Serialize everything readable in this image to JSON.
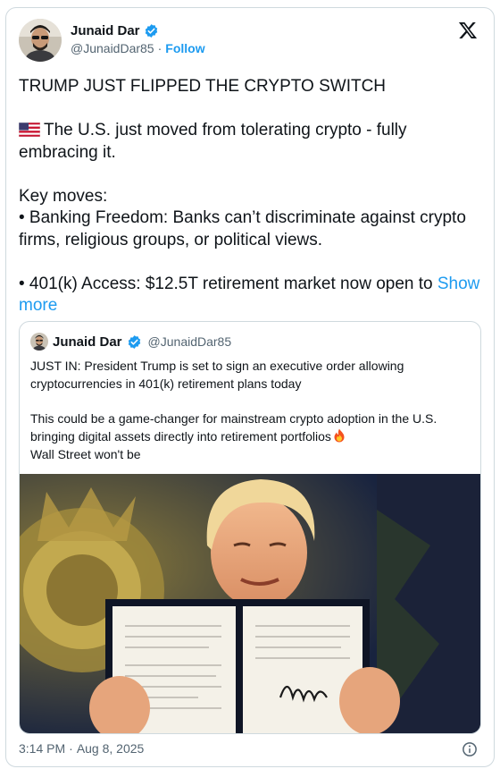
{
  "author": {
    "display_name": "Junaid Dar",
    "handle": "@JunaidDar85",
    "separator": "·",
    "follow_label": "Follow",
    "verified_icon": "verified-badge-icon",
    "verified_color": "#1d9bf0"
  },
  "platform_icon": "x-logo-icon",
  "tweet": {
    "line1": "TRUMP JUST FLIPPED THE CRYPTO SWITCH",
    "flag_icon": "us-flag-icon",
    "line2": "The U.S. just moved from tolerating crypto - fully embracing it.",
    "line3": "Key moves:",
    "line4": "• Banking Freedom: Banks can’t discriminate against crypto firms, religious groups, or political views.",
    "line5": "• 401(k) Access: $12.5T retirement market now open to ",
    "show_more": "Show more"
  },
  "quoted": {
    "display_name": "Junaid Dar",
    "handle": "@JunaidDar85",
    "line1": "JUST IN: President Trump is set to sign an executive order allowing cryptocurrencies in 401(k) retirement plans today",
    "line2": "This could be a game-changer for mainstream crypto adoption in the U.S. bringing digital assets directly into retirement portfolios",
    "fire_icon": "fire-emoji-icon",
    "line3": "Wall Street won't be",
    "photo_icon": "president-holding-signed-order-photo"
  },
  "footer": {
    "time": "3:14 PM",
    "separator": "·",
    "date": "Aug 8, 2025",
    "info_icon": "info-icon"
  },
  "colors": {
    "accent": "#1d9bf0",
    "text": "#0f1419",
    "muted": "#536471",
    "border": "#cfd9de"
  }
}
